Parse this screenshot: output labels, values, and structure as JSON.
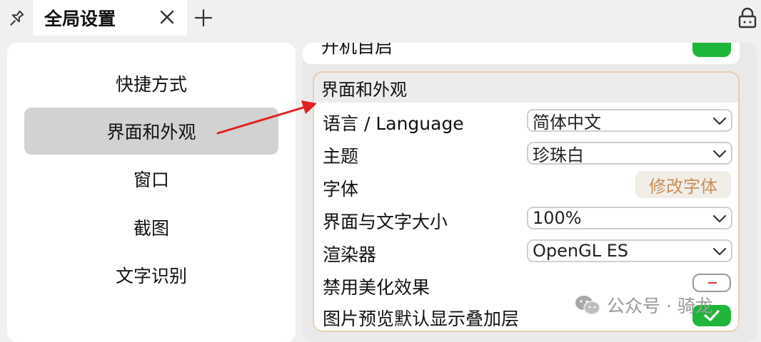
{
  "tab": {
    "title": "全局设置"
  },
  "sidebar": {
    "items": [
      {
        "label": "快捷方式"
      },
      {
        "label": "界面和外观"
      },
      {
        "label": "窗口"
      },
      {
        "label": "截图"
      },
      {
        "label": "文字识别"
      }
    ],
    "active_index": 1
  },
  "content": {
    "partial_row": {
      "label": "开机自启",
      "state": "on"
    },
    "group": {
      "title": "界面和外观",
      "language": {
        "label": "语言 / Language",
        "value": "简体中文"
      },
      "theme": {
        "label": "主题",
        "value": "珍珠白"
      },
      "font": {
        "label": "字体",
        "button": "修改字体"
      },
      "ui_size": {
        "label": "界面与文字大小",
        "value": "100%"
      },
      "renderer": {
        "label": "渲染器",
        "value": "OpenGL ES"
      },
      "disable_beautify": {
        "label": "禁用美化效果",
        "state": "off"
      },
      "preview_overlay": {
        "label": "图片预览默认显示叠加层",
        "state": "on"
      }
    }
  },
  "watermark": {
    "text": "公众号 · 骑龙"
  },
  "icons": {
    "pin": "pin-icon",
    "close": "close-icon",
    "add": "plus-icon",
    "lock": "lock-icon",
    "dropdown": "chevron-down-icon",
    "check": "check-icon",
    "wechat": "wechat-icon"
  },
  "colors": {
    "toggle_on": "#1fb53a",
    "toggle_off_mark": "#e0303a",
    "accent_button_text": "#c8905a",
    "group_border": "#e6cfb0",
    "annotation_arrow": "#e02020",
    "active_nav": "#d2d2d2"
  }
}
